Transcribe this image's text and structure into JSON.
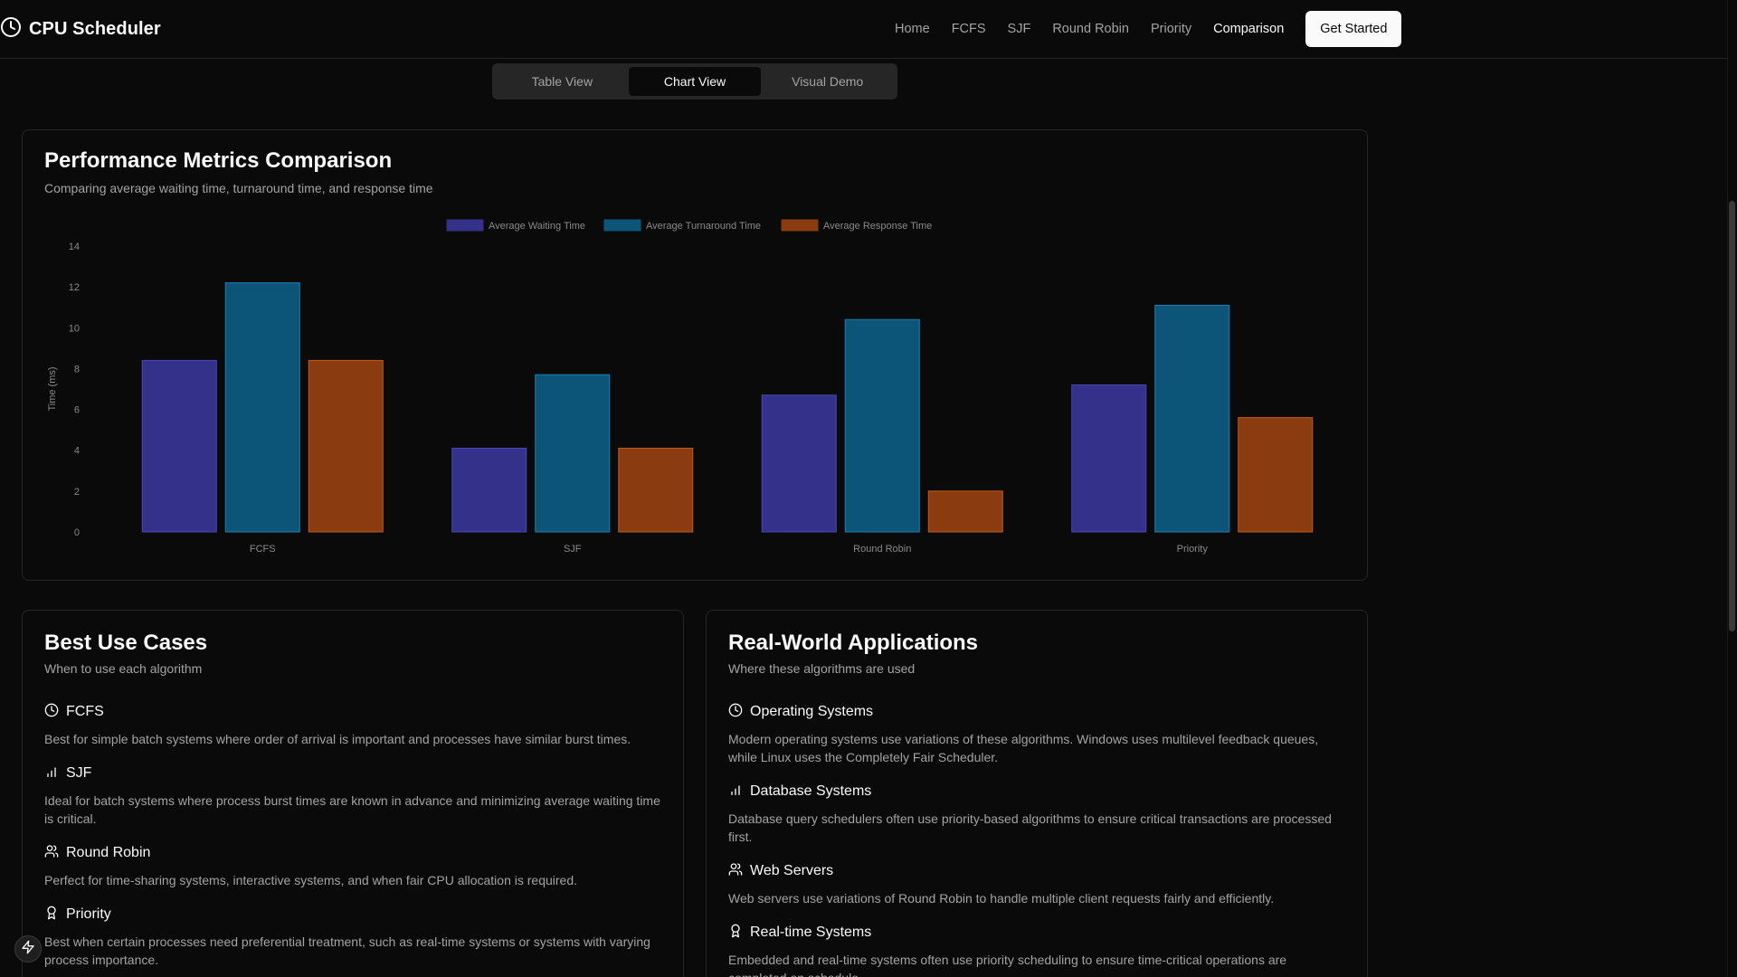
{
  "header": {
    "title": "CPU Scheduler",
    "nav": [
      "Home",
      "FCFS",
      "SJF",
      "Round Robin",
      "Priority",
      "Comparison"
    ],
    "active_nav": "Comparison",
    "cta_label": "Get Started"
  },
  "tabs": {
    "items": [
      "Table View",
      "Chart View",
      "Visual Demo"
    ],
    "active": "Chart View"
  },
  "chart_card": {
    "title": "Performance Metrics Comparison",
    "subtitle": "Comparing average waiting time, turnaround time, and response time"
  },
  "chart_data": {
    "type": "bar",
    "categories": [
      "FCFS",
      "SJF",
      "Round Robin",
      "Priority"
    ],
    "series": [
      {
        "name": "Average Waiting Time",
        "values": [
          8.4,
          4.1,
          6.7,
          7.2
        ],
        "color": "#34318a"
      },
      {
        "name": "Average Turnaround Time",
        "values": [
          12.2,
          7.7,
          10.4,
          11.1
        ],
        "color": "#0c5579"
      },
      {
        "name": "Average Response Time",
        "values": [
          8.4,
          4.1,
          2.0,
          5.6
        ],
        "color": "#8a3c10"
      }
    ],
    "ylabel": "Time (ms)",
    "xlabel": "",
    "ylim": [
      0,
      14
    ],
    "yticks": [
      0,
      2,
      4,
      6,
      8,
      10,
      12,
      14
    ],
    "legend": "top-center",
    "grid": false
  },
  "use_cases": {
    "title": "Best Use Cases",
    "subtitle": "When to use each algorithm",
    "items": [
      {
        "icon": "clock-icon",
        "title": "FCFS",
        "desc": "Best for simple batch systems where order of arrival is important and processes have similar burst times."
      },
      {
        "icon": "bar-chart-icon",
        "title": "SJF",
        "desc": "Ideal for batch systems where process burst times are known in advance and minimizing average waiting time is critical."
      },
      {
        "icon": "users-icon",
        "title": "Round Robin",
        "desc": "Perfect for time-sharing systems, interactive systems, and when fair CPU allocation is required."
      },
      {
        "icon": "award-icon",
        "title": "Priority",
        "desc": "Best when certain processes need preferential treatment, such as real-time systems or systems with varying process importance."
      }
    ]
  },
  "applications": {
    "title": "Real-World Applications",
    "subtitle": "Where these algorithms are used",
    "items": [
      {
        "icon": "clock-icon",
        "title": "Operating Systems",
        "desc": "Modern operating systems use variations of these algorithms. Windows uses multilevel feedback queues, while Linux uses the Completely Fair Scheduler."
      },
      {
        "icon": "bar-chart-icon",
        "title": "Database Systems",
        "desc": "Database query schedulers often use priority-based algorithms to ensure critical transactions are processed first."
      },
      {
        "icon": "users-icon",
        "title": "Web Servers",
        "desc": "Web servers use variations of Round Robin to handle multiple client requests fairly and efficiently."
      },
      {
        "icon": "award-icon",
        "title": "Real-time Systems",
        "desc": "Embedded and real-time systems often use priority scheduling to ensure time-critical operations are completed on schedule."
      }
    ]
  },
  "floating_button": {
    "icon": "lightning-icon"
  },
  "colors": {
    "background": "#0a0a0a",
    "border": "#262626",
    "muted_text": "#a3a3a3",
    "text": "#fafafa"
  }
}
